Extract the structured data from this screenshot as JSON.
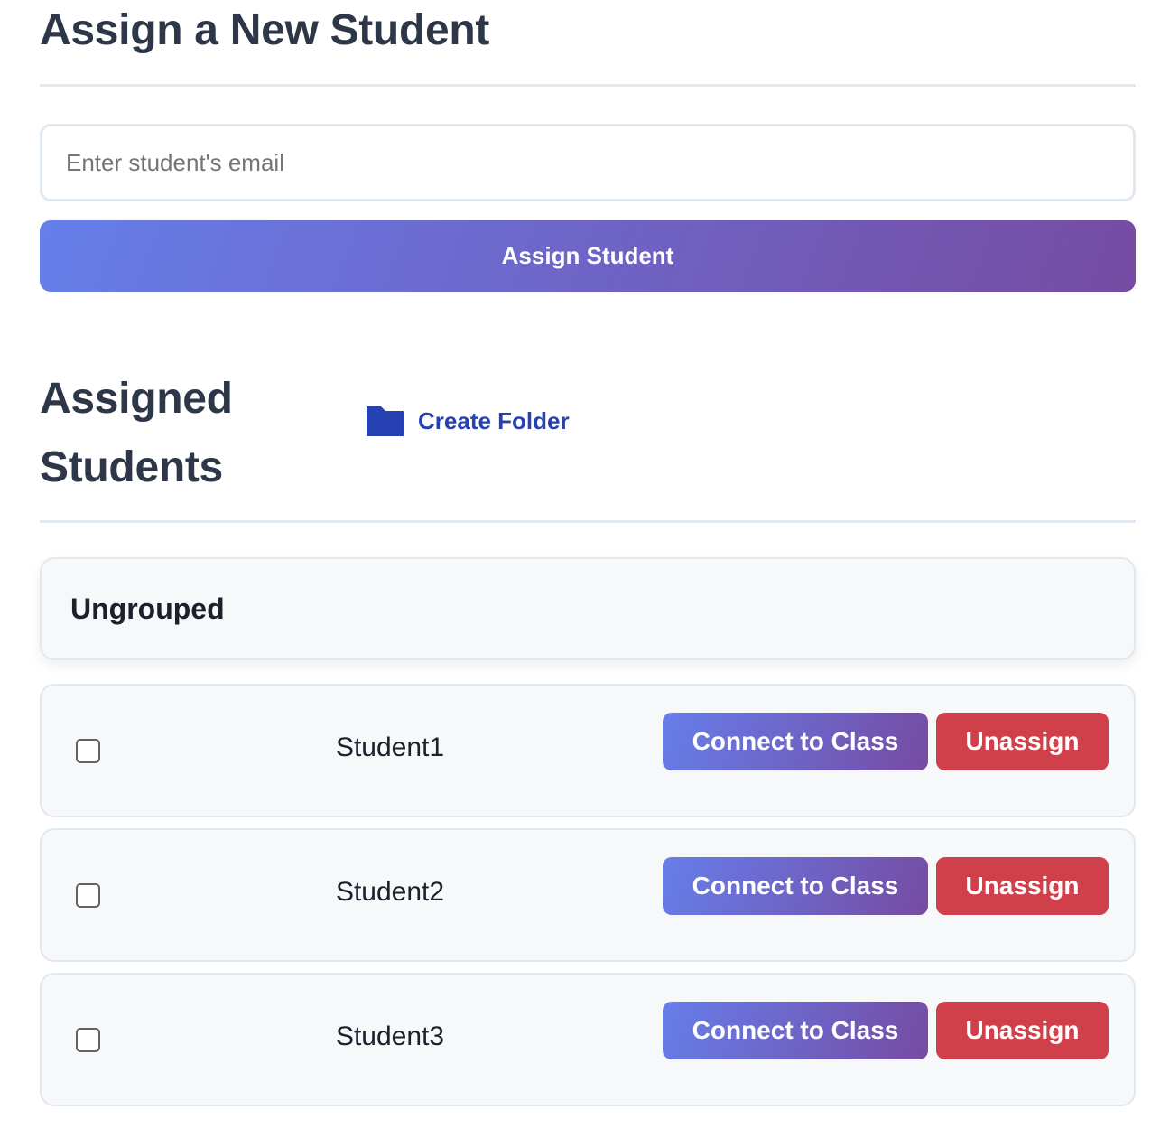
{
  "assign_section": {
    "title": "Assign a New Student",
    "email_placeholder": "Enter student's email",
    "email_value": "",
    "assign_button_label": "Assign Student"
  },
  "assigned_section": {
    "title": "Assigned Students",
    "create_folder_label": "Create Folder",
    "folder_icon": "folder-icon"
  },
  "groups": [
    {
      "name": "Ungrouped",
      "students": [
        {
          "name": "Student1",
          "checked": false,
          "connect_label": "Connect to Class",
          "unassign_label": "Unassign"
        },
        {
          "name": "Student2",
          "checked": false,
          "connect_label": "Connect to Class",
          "unassign_label": "Unassign"
        },
        {
          "name": "Student3",
          "checked": false,
          "connect_label": "Connect to Class",
          "unassign_label": "Unassign"
        }
      ]
    }
  ],
  "colors": {
    "heading": "#2d3748",
    "accent_gradient_start": "#667eea",
    "accent_gradient_end": "#764ba2",
    "danger": "#d0404b",
    "link": "#2541b2",
    "row_background": "#f7f8fa",
    "border": "#e2e8f0"
  }
}
